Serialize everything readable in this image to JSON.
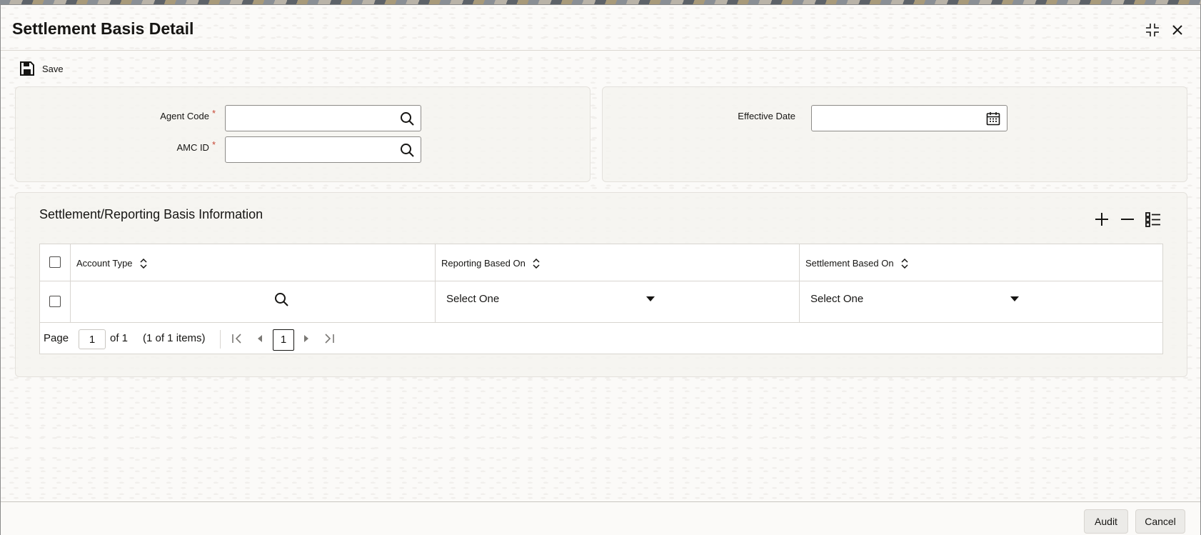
{
  "window": {
    "title": "Settlement Basis Detail"
  },
  "toolbar": {
    "save_label": "Save"
  },
  "header_fields": {
    "agent_code": {
      "label": "Agent Code",
      "required_mark": "*",
      "value": ""
    },
    "amc_id": {
      "label": "AMC ID",
      "required_mark": "*",
      "value": ""
    },
    "effective_date": {
      "label": "Effective Date",
      "value": ""
    }
  },
  "section": {
    "title": "Settlement/Reporting Basis Information"
  },
  "grid": {
    "columns": [
      "Account Type",
      "Reporting Based On",
      "Settlement Based On"
    ],
    "rows": [
      {
        "account_type": "",
        "reporting_based_on": "Select One",
        "settlement_based_on": "Select One"
      }
    ]
  },
  "pager": {
    "page_label": "Page",
    "current_page": "1",
    "of_label": "of 1",
    "items_label": "(1 of 1 items)",
    "page_button": "1"
  },
  "footer": {
    "audit_label": "Audit",
    "cancel_label": "Cancel"
  },
  "colors": {
    "required": "#c74634",
    "text": "#161513",
    "background": "#fbfaf8"
  }
}
